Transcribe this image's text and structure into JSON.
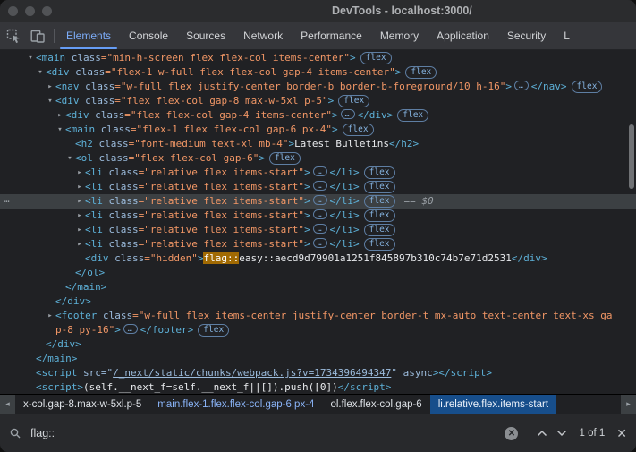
{
  "window": {
    "title": "DevTools - localhost:3000/"
  },
  "toolbar": {
    "tabs": [
      {
        "label": "Elements",
        "active": true
      },
      {
        "label": "Console"
      },
      {
        "label": "Sources"
      },
      {
        "label": "Network"
      },
      {
        "label": "Performance"
      },
      {
        "label": "Memory"
      },
      {
        "label": "Application"
      },
      {
        "label": "Security"
      },
      {
        "label": "L"
      }
    ]
  },
  "tree": {
    "lines": [
      {
        "indent": 0,
        "arrow": "exp",
        "tokens": [
          [
            "tag",
            "<main"
          ],
          [
            "attr",
            " class"
          ],
          [
            "val",
            "=\"min-h-screen flex flex-col items-center\""
          ],
          [
            "tag",
            ">"
          ],
          [
            "badge",
            "flex"
          ]
        ]
      },
      {
        "indent": 1,
        "arrow": "exp",
        "tokens": [
          [
            "tag",
            "<div"
          ],
          [
            "attr",
            " class"
          ],
          [
            "val",
            "=\"flex-1 w-full flex flex-col gap-4 items-center\""
          ],
          [
            "tag",
            ">"
          ],
          [
            "badge",
            "flex"
          ]
        ]
      },
      {
        "indent": 2,
        "arrow": "col",
        "tokens": [
          [
            "tag",
            "<nav"
          ],
          [
            "attr",
            " class"
          ],
          [
            "val",
            "=\"w-full flex justify-center border-b border-b-foreground/10 h-16\""
          ],
          [
            "tag",
            ">"
          ],
          [
            "more",
            "…"
          ],
          [
            "tag",
            "</nav>"
          ],
          [
            "badge",
            "flex"
          ]
        ]
      },
      {
        "indent": 2,
        "arrow": "exp",
        "tokens": [
          [
            "tag",
            "<div"
          ],
          [
            "attr",
            " class"
          ],
          [
            "val",
            "=\"flex flex-col gap-8 max-w-5xl p-5\""
          ],
          [
            "tag",
            ">"
          ],
          [
            "badge",
            "flex"
          ]
        ]
      },
      {
        "indent": 3,
        "arrow": "col",
        "tokens": [
          [
            "tag",
            "<div"
          ],
          [
            "attr",
            " class"
          ],
          [
            "val",
            "=\"flex flex-col gap-4 items-center\""
          ],
          [
            "tag",
            ">"
          ],
          [
            "more",
            "…"
          ],
          [
            "tag",
            "</div>"
          ],
          [
            "badge",
            "flex"
          ]
        ]
      },
      {
        "indent": 3,
        "arrow": "exp",
        "tokens": [
          [
            "tag",
            "<main"
          ],
          [
            "attr",
            " class"
          ],
          [
            "val",
            "=\"flex-1 flex flex-col gap-6 px-4\""
          ],
          [
            "tag",
            ">"
          ],
          [
            "badge",
            "flex"
          ]
        ]
      },
      {
        "indent": 4,
        "arrow": "none",
        "tokens": [
          [
            "tag",
            "<h2"
          ],
          [
            "attr",
            " class"
          ],
          [
            "val",
            "=\"font-medium text-xl mb-4\""
          ],
          [
            "tag",
            ">"
          ],
          [
            "txt",
            "Latest Bulletins"
          ],
          [
            "tag",
            "</h2>"
          ]
        ]
      },
      {
        "indent": 4,
        "arrow": "exp",
        "tokens": [
          [
            "tag",
            "<ol"
          ],
          [
            "attr",
            " class"
          ],
          [
            "val",
            "=\"flex flex-col gap-6\""
          ],
          [
            "tag",
            ">"
          ],
          [
            "badge",
            "flex"
          ]
        ]
      },
      {
        "indent": 5,
        "arrow": "col",
        "tokens": [
          [
            "tag",
            "<li"
          ],
          [
            "attr",
            " class"
          ],
          [
            "val",
            "=\"relative flex items-start\""
          ],
          [
            "tag",
            ">"
          ],
          [
            "more",
            "…"
          ],
          [
            "tag",
            "</li>"
          ],
          [
            "badge",
            "flex"
          ]
        ]
      },
      {
        "indent": 5,
        "arrow": "col",
        "tokens": [
          [
            "tag",
            "<li"
          ],
          [
            "attr",
            " class"
          ],
          [
            "val",
            "=\"relative flex items-start\""
          ],
          [
            "tag",
            ">"
          ],
          [
            "more",
            "…"
          ],
          [
            "tag",
            "</li>"
          ],
          [
            "badge",
            "flex"
          ]
        ]
      },
      {
        "indent": 5,
        "arrow": "col",
        "selected": true,
        "gutter": "…",
        "tokens": [
          [
            "tag",
            "<li"
          ],
          [
            "attr",
            " class"
          ],
          [
            "val",
            "=\"relative flex items-start\""
          ],
          [
            "tag",
            ">"
          ],
          [
            "more",
            "…"
          ],
          [
            "tag",
            "</li>"
          ],
          [
            "badge",
            "flex"
          ],
          [
            "eq",
            "== $0"
          ]
        ]
      },
      {
        "indent": 5,
        "arrow": "col",
        "tokens": [
          [
            "tag",
            "<li"
          ],
          [
            "attr",
            " class"
          ],
          [
            "val",
            "=\"relative flex items-start\""
          ],
          [
            "tag",
            ">"
          ],
          [
            "more",
            "…"
          ],
          [
            "tag",
            "</li>"
          ],
          [
            "badge",
            "flex"
          ]
        ]
      },
      {
        "indent": 5,
        "arrow": "col",
        "tokens": [
          [
            "tag",
            "<li"
          ],
          [
            "attr",
            " class"
          ],
          [
            "val",
            "=\"relative flex items-start\""
          ],
          [
            "tag",
            ">"
          ],
          [
            "more",
            "…"
          ],
          [
            "tag",
            "</li>"
          ],
          [
            "badge",
            "flex"
          ]
        ]
      },
      {
        "indent": 5,
        "arrow": "col",
        "tokens": [
          [
            "tag",
            "<li"
          ],
          [
            "attr",
            " class"
          ],
          [
            "val",
            "=\"relative flex items-start\""
          ],
          [
            "tag",
            ">"
          ],
          [
            "more",
            "…"
          ],
          [
            "tag",
            "</li>"
          ],
          [
            "badge",
            "flex"
          ]
        ]
      },
      {
        "indent": 5,
        "arrow": "none",
        "tokens": [
          [
            "tag",
            "<div"
          ],
          [
            "attr",
            " class"
          ],
          [
            "val",
            "=\"hidden\""
          ],
          [
            "tag",
            ">"
          ],
          [
            "hl",
            "flag::"
          ],
          [
            "txt",
            "easy::aecd9d79901a1251f845897b310c74b7e71d2531"
          ],
          [
            "tag",
            "</div>"
          ]
        ]
      },
      {
        "indent": 4,
        "arrow": "none",
        "tokens": [
          [
            "tag",
            "</ol>"
          ]
        ]
      },
      {
        "indent": 3,
        "arrow": "none",
        "tokens": [
          [
            "tag",
            "</main>"
          ]
        ]
      },
      {
        "indent": 2,
        "arrow": "none",
        "tokens": [
          [
            "tag",
            "</div>"
          ]
        ]
      },
      {
        "indent": 2,
        "arrow": "col",
        "wrap": true,
        "tokens": [
          [
            "tag",
            "<footer"
          ],
          [
            "attr",
            " class"
          ],
          [
            "val",
            "=\"w-full flex items-center justify-center border-t mx-auto text-center text-xs gap-8 py-16\""
          ],
          [
            "tag",
            ">"
          ],
          [
            "more",
            "…"
          ],
          [
            "tag",
            "</footer>"
          ],
          [
            "badge",
            "flex"
          ]
        ]
      },
      {
        "indent": 1,
        "arrow": "none",
        "tokens": [
          [
            "tag",
            "</div>"
          ]
        ]
      },
      {
        "indent": 0,
        "arrow": "none",
        "tokens": [
          [
            "tag",
            "</main>"
          ]
        ]
      },
      {
        "indent": 0,
        "arrow": "none",
        "tokens": [
          [
            "tag",
            "<script"
          ],
          [
            "attr",
            " src"
          ],
          [
            "attr",
            "=\""
          ],
          [
            "link",
            "/_next/static/chunks/webpack.js?v=1734396494347"
          ],
          [
            "attr",
            "\""
          ],
          [
            "attr",
            " async"
          ],
          [
            "tag",
            ">"
          ],
          [
            "tag",
            "</script>"
          ]
        ]
      },
      {
        "indent": 0,
        "arrow": "none",
        "tokens": [
          [
            "tag",
            "<script"
          ],
          [
            "tag",
            ">"
          ],
          [
            "txt",
            "(self.__next_f=self.__next_f||[]).push([0])"
          ],
          [
            "tag",
            "</script>"
          ]
        ]
      }
    ]
  },
  "breadcrumbs": {
    "items": [
      {
        "label": "x-col.gap-8.max-w-5xl.p-5",
        "tone": "plain"
      },
      {
        "label": "main.flex-1.flex.flex-col.gap-6.px-4",
        "tone": "link"
      },
      {
        "label": "ol.flex.flex-col.gap-6",
        "tone": "plain"
      },
      {
        "label": "li.relative.flex.items-start",
        "selected": true
      }
    ],
    "left_arrow": "◂",
    "right_arrow": "▸"
  },
  "search": {
    "query": "flag::",
    "results": "1 of 1"
  }
}
